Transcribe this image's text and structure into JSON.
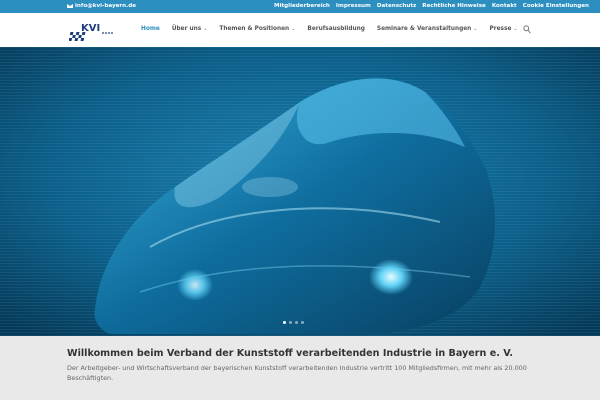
{
  "topbar": {
    "email": "info@kvi-bayern.de",
    "links": [
      "Mitgliederbereich",
      "Impressum",
      "Datenschutz",
      "Rechtliche Hinweise",
      "Kontakt",
      "Cookie Einstellungen"
    ]
  },
  "header": {
    "logo_text": "KVI",
    "nav": [
      {
        "label": "Home",
        "active": true,
        "dropdown": false
      },
      {
        "label": "Über uns",
        "active": false,
        "dropdown": true
      },
      {
        "label": "Themen & Positionen",
        "active": false,
        "dropdown": true
      },
      {
        "label": "Berufsausbildung",
        "active": false,
        "dropdown": false
      },
      {
        "label": "Seminare & Veranstaltungen",
        "active": false,
        "dropdown": true
      },
      {
        "label": "Presse",
        "active": false,
        "dropdown": true
      }
    ]
  },
  "hero": {
    "slides": 4,
    "active_slide": 0
  },
  "main": {
    "title": "Willkommen beim Verband der Kunststoff verarbeitenden Industrie in Bayern e. V.",
    "text": "Der Arbeitgeber- und Wirtschaftsverband der bayerischen Kunststoff verarbeitenden Industrie vertritt 100 Mitgliedsfirmen, mit mehr als 20.000 Beschäftigten."
  },
  "colors": {
    "accent": "#2d8ec0",
    "hero_bg": "#0a5a82",
    "content_bg": "#e9e9e9"
  },
  "icons": {
    "mail": "mail-icon",
    "search": "search-icon",
    "dropdown": "chevron-down-icon"
  }
}
